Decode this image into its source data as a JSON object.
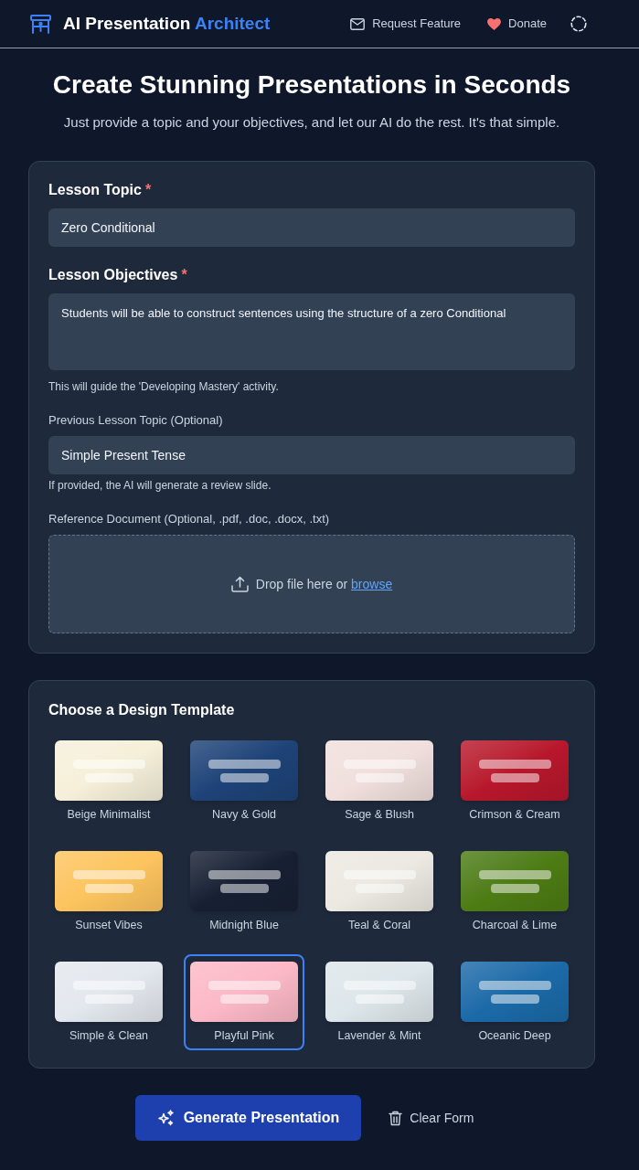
{
  "header": {
    "title": "AI Presentation",
    "title_accent": "Architect",
    "links": [
      {
        "label": "Request Feature"
      },
      {
        "label": "Donate"
      }
    ]
  },
  "hero": {
    "heading": "Create Stunning Presentations in Seconds",
    "subheading": "Just provide a topic and your objectives, and let our AI do the rest. It's that simple."
  },
  "form": {
    "fields": [
      {
        "kind": "input",
        "label": "Lesson Topic",
        "required_mark": "*",
        "value": "Zero Conditional"
      },
      {
        "kind": "textarea",
        "label": "Lesson Objectives",
        "required_mark": "*",
        "value": "Students will be able to construct sentences using the structure of a zero Conditional",
        "hint": "This will guide the 'Developing Mastery' activity."
      },
      {
        "kind": "input",
        "label": "Previous Lesson Topic (Optional)",
        "value": "Simple Present Tense",
        "hint": "If provided, the AI will generate a review slide."
      },
      {
        "kind": "dropzone",
        "label": "Reference Document (Optional, .pdf, .doc, .docx, .txt)",
        "text": "Drop file here or",
        "link": "browse"
      }
    ]
  },
  "templates": {
    "title": "Choose a Design Template",
    "items": [
      {
        "name": "Beige Minimalist",
        "color": "#f6f0da",
        "selected": false
      },
      {
        "name": "Navy & Gold",
        "color": "#1e4378",
        "selected": false
      },
      {
        "name": "Sage & Blush",
        "color": "#f0dfdd",
        "selected": false
      },
      {
        "name": "Crimson & Cream",
        "color": "#b8172c",
        "selected": false
      },
      {
        "name": "Sunset Vibes",
        "color": "#fdc45e",
        "selected": false
      },
      {
        "name": "Midnight Blue",
        "color": "#172033",
        "selected": false
      },
      {
        "name": "Teal & Coral",
        "color": "#ece9e2",
        "selected": false
      },
      {
        "name": "Charcoal & Lime",
        "color": "#4d7c14",
        "selected": false
      },
      {
        "name": "Simple & Clean",
        "color": "#e3e8ee",
        "selected": false
      },
      {
        "name": "Playful Pink",
        "color": "#fcb8c6",
        "selected": true
      },
      {
        "name": "Lavender & Mint",
        "color": "#dde6ea",
        "selected": false
      },
      {
        "name": "Oceanic Deep",
        "color": "#1b6aa8",
        "selected": false
      }
    ]
  },
  "actions": [
    {
      "kind": "primary",
      "label": "Generate Presentation"
    },
    {
      "kind": "secondary",
      "label": "Clear Form"
    }
  ]
}
